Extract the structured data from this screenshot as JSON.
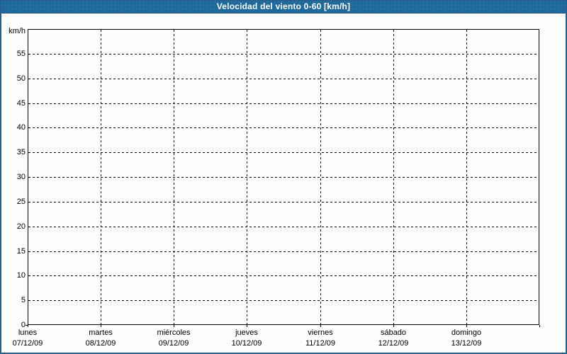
{
  "header": {
    "title": "Velocidad del viento 0-60 [km/h]",
    "background": "#1e699c",
    "text_color": "#ffffff",
    "bottom_edge_color": "#124a73"
  },
  "frame": {
    "border_color": "#27618f",
    "background": "#fcfdfc",
    "grid_color": "#000000"
  },
  "chart_data": {
    "type": "line",
    "title": "Velocidad del viento 0-60 [km/h]",
    "y_unit": "km/h",
    "ylabel": "km/h",
    "xlabel": "",
    "ylim": [
      0,
      60
    ],
    "y_tick_step": 5,
    "y_tick_labels": [
      0,
      5,
      10,
      15,
      20,
      25,
      30,
      35,
      40,
      45,
      50,
      55
    ],
    "categories": [
      {
        "day": "lunes",
        "date": "07/12/09"
      },
      {
        "day": "martes",
        "date": "08/12/09"
      },
      {
        "day": "miércoles",
        "date": "09/12/09"
      },
      {
        "day": "jueves",
        "date": "10/12/09"
      },
      {
        "day": "viernes",
        "date": "11/12/09"
      },
      {
        "day": "sábado",
        "date": "12/12/09"
      },
      {
        "day": "domingo",
        "date": "13/12/09"
      }
    ],
    "series": [],
    "grid": "dashed",
    "legend_position": "none"
  }
}
